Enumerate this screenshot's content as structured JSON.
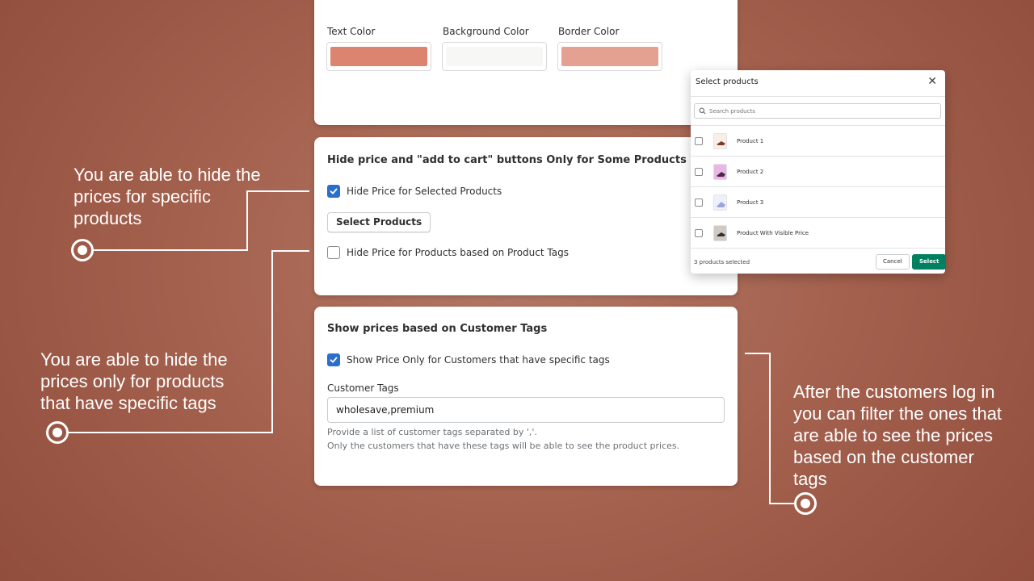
{
  "colors_card": {
    "text_color_label": "Text Color",
    "background_color_label": "Background Color",
    "border_color_label": "Border Color",
    "text_color_value": "#dd8470",
    "background_color_value": "#f7f7f6",
    "border_color_value": "#e4a191"
  },
  "products_card": {
    "title": "Hide price and \"add to cart\" buttons Only for Some Products",
    "hide_selected_label": "Hide Price for Selected Products",
    "hide_selected_checked": true,
    "select_products_button": "Select Products",
    "hide_by_tags_label": "Hide Price for Products based on Product Tags",
    "hide_by_tags_checked": false
  },
  "customer_tags_card": {
    "title": "Show prices based on Customer Tags",
    "show_only_label": "Show Price Only for Customers that have specific tags",
    "show_only_checked": true,
    "field_label": "Customer Tags",
    "field_value": "wholesave,premium",
    "help_line_1": "Provide a list of customer tags separated by ','.",
    "help_line_2": "Only the customers that have these tags will be able to see the product prices."
  },
  "modal": {
    "title": "Select products",
    "search_placeholder": "Search products",
    "products": [
      {
        "name": "Product 1",
        "checked": false,
        "thumb_icon": "bag-image"
      },
      {
        "name": "Product 2",
        "checked": false,
        "thumb_icon": "bag-image"
      },
      {
        "name": "Product 3",
        "checked": false,
        "thumb_icon": "bag-image"
      },
      {
        "name": "Product With Visible Price",
        "checked": false,
        "thumb_icon": "bag-image"
      }
    ],
    "selected_count_text": "3 products selected",
    "cancel_button": "Cancel",
    "select_button": "Select",
    "select_button_color": "#008060"
  },
  "annotations": {
    "first": "You are able to hide the prices for specific products",
    "second": "You are able to hide the prices only for products that have specific tags",
    "third": "After the customers log in you can filter the ones that are able to see the prices based on the customer tags"
  },
  "theme": {
    "checkbox_color": "#2c6ecb",
    "background_color": "#a4614e"
  }
}
